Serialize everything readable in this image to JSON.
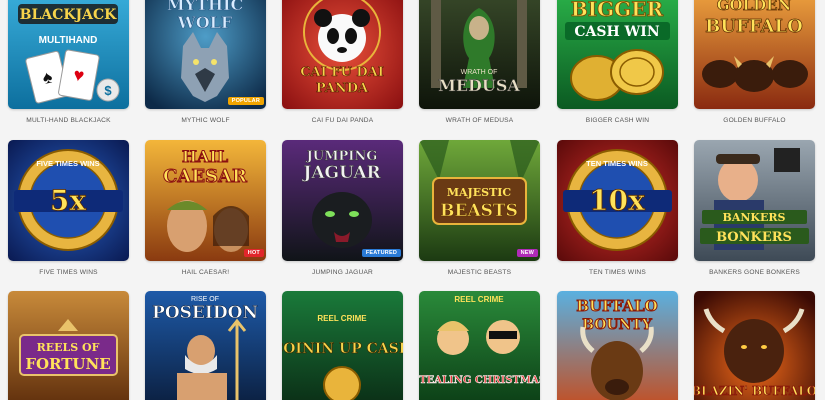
{
  "games": [
    {
      "title": "MULTI-HAND BLACKJACK",
      "art_lines": [
        "BLACKJACK",
        "MULTIHAND"
      ],
      "badge": ""
    },
    {
      "title": "MYTHIC WOLF",
      "art_lines": [
        "MYTHIC",
        "WOLF"
      ],
      "badge": "POPULAR"
    },
    {
      "title": "CAI FU DAI PANDA",
      "art_lines": [
        "CAI FU DAI",
        "PANDA"
      ],
      "badge": ""
    },
    {
      "title": "WRATH OF MEDUSA",
      "art_lines": [
        "WRATH OF",
        "MEDUSA"
      ],
      "badge": ""
    },
    {
      "title": "BIGGER CASH WIN",
      "art_lines": [
        "BIGGER",
        "CASH WIN"
      ],
      "badge": ""
    },
    {
      "title": "GOLDEN BUFFALO",
      "art_lines": [
        "GOLDEN",
        "BUFFALO"
      ],
      "badge": ""
    },
    {
      "title": "FIVE TIMES WINS",
      "art_lines": [
        "5x",
        "FIVE TIMES WINS"
      ],
      "badge": ""
    },
    {
      "title": "HAIL CAESAR!",
      "art_lines": [
        "HAIL",
        "CAESAR"
      ],
      "badge": "HOT"
    },
    {
      "title": "JUMPING JAGUAR",
      "art_lines": [
        "JUMPING",
        "JAGUAR"
      ],
      "badge": "FEATURED"
    },
    {
      "title": "MAJESTIC BEASTS",
      "art_lines": [
        "MAJESTIC",
        "BEASTS"
      ],
      "badge": "NEW"
    },
    {
      "title": "TEN TIMES WINS",
      "art_lines": [
        "10x",
        "TEN TIMES WINS"
      ],
      "badge": ""
    },
    {
      "title": "BANKERS GONE BONKERS",
      "art_lines": [
        "BANKERS",
        "BONKERS"
      ],
      "badge": ""
    },
    {
      "title": "",
      "art_lines": [
        "REELS OF",
        "FORTUNE"
      ],
      "badge": ""
    },
    {
      "title": "",
      "art_lines": [
        "RISE OF",
        "POSEIDON"
      ],
      "badge": ""
    },
    {
      "title": "",
      "art_lines": [
        "REEL CRIME",
        "COININ UP CASH"
      ],
      "badge": ""
    },
    {
      "title": "",
      "art_lines": [
        "REEL CRIME",
        "STEALING CHRISTMAS"
      ],
      "badge": ""
    },
    {
      "title": "",
      "art_lines": [
        "BUFFALO",
        "BOUNTY"
      ],
      "badge": ""
    },
    {
      "title": "",
      "art_lines": [
        "BLAZIN' BUFFALO",
        ""
      ],
      "badge": ""
    }
  ],
  "colors": {
    "page_bg": "#f4f4f4",
    "caption": "#555555",
    "badge_popular": "#f0a400",
    "badge_hot": "#e0262b",
    "badge_featured": "#2a7ad5",
    "badge_new": "#b02ab8"
  }
}
